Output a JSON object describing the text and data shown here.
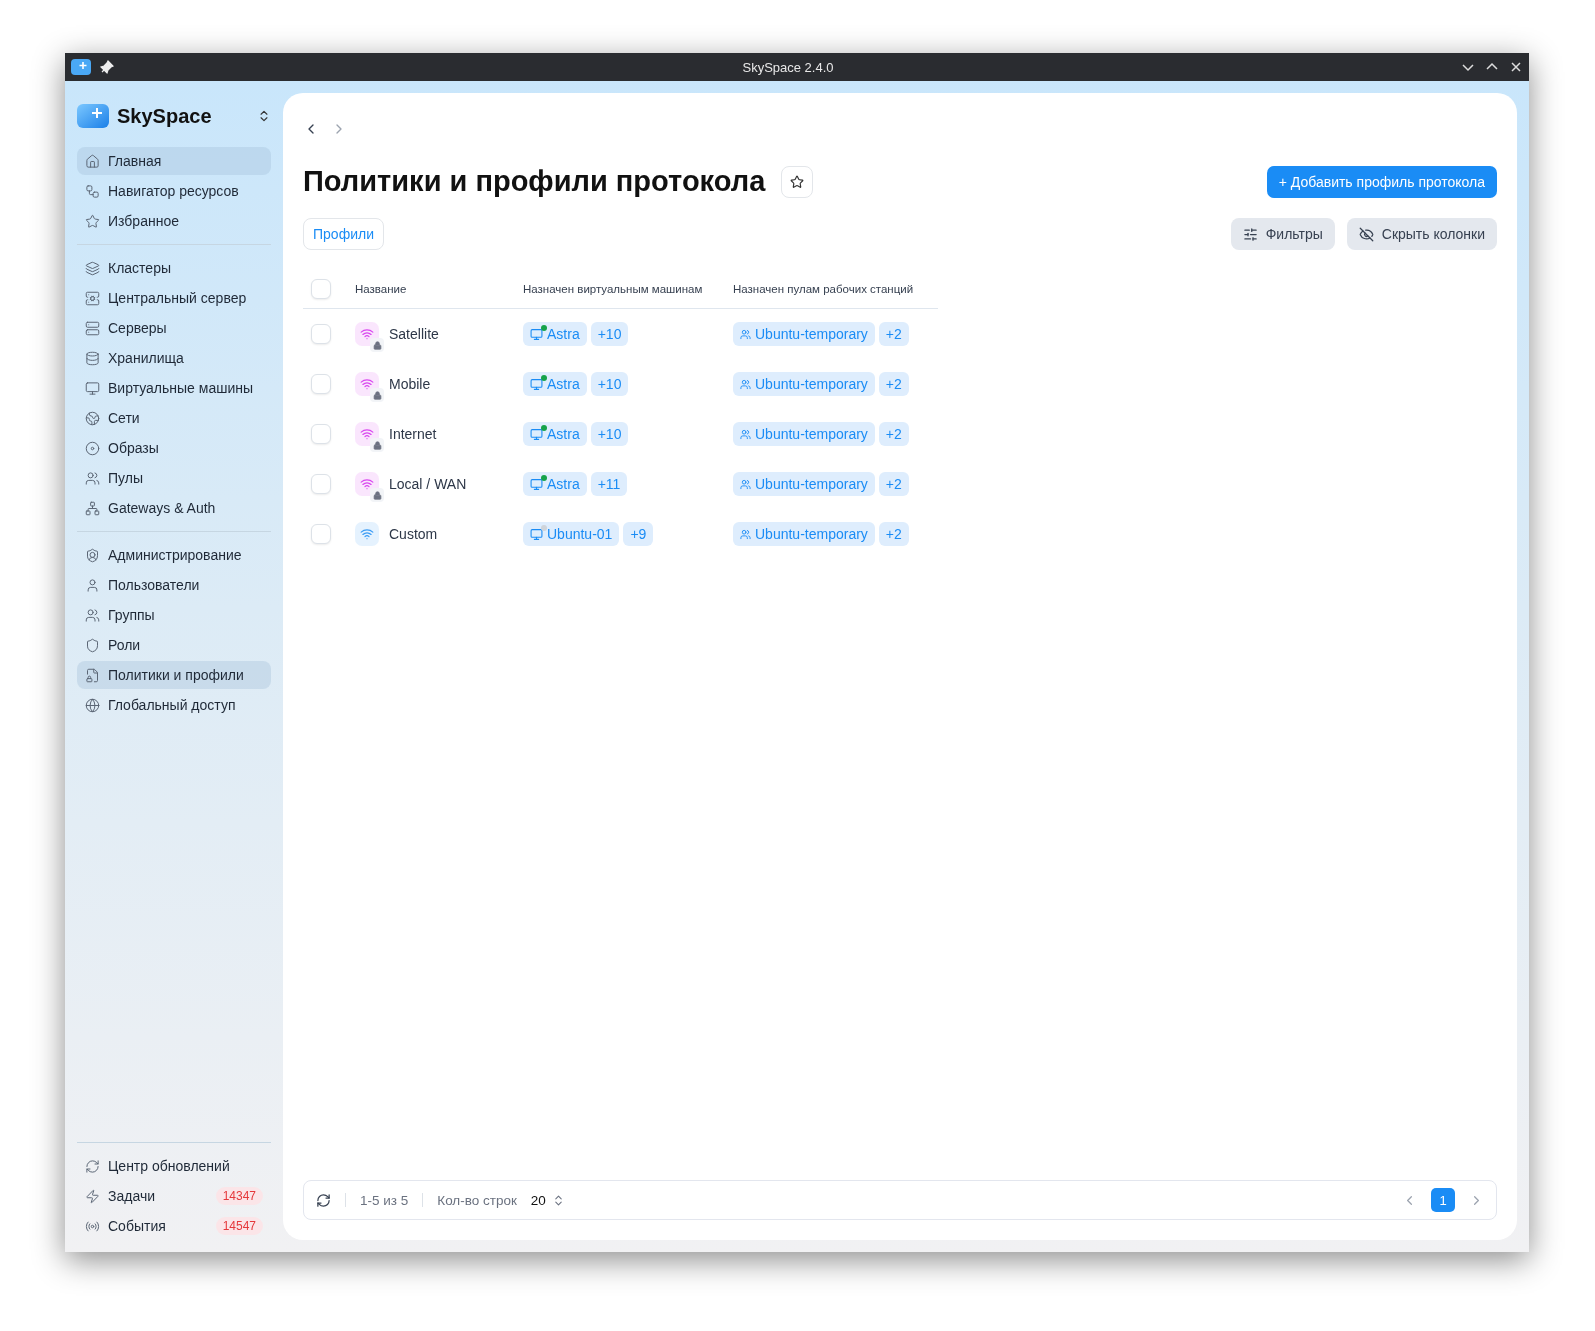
{
  "window": {
    "title": "SkySpace 2.4.0"
  },
  "sidebar": {
    "brand": "SkySpace",
    "groups": [
      [
        {
          "label": "Главная",
          "selected": true
        },
        {
          "label": "Навигатор ресурсов",
          "selected": false
        },
        {
          "label": "Избранное",
          "selected": false
        }
      ],
      [
        {
          "label": "Кластеры",
          "selected": false
        },
        {
          "label": "Центральный сервер",
          "selected": false
        },
        {
          "label": "Серверы",
          "selected": false
        },
        {
          "label": "Хранилища",
          "selected": false
        },
        {
          "label": "Виртуальные машины",
          "selected": false
        },
        {
          "label": "Сети",
          "selected": false
        },
        {
          "label": "Образы",
          "selected": false
        },
        {
          "label": "Пулы",
          "selected": false
        },
        {
          "label": "Gateways & Auth",
          "selected": false
        }
      ],
      [
        {
          "label": "Администрирование",
          "selected": false
        },
        {
          "label": "Пользователи",
          "selected": false
        },
        {
          "label": "Группы",
          "selected": false
        },
        {
          "label": "Роли",
          "selected": false
        },
        {
          "label": "Политики и профили",
          "selected": true
        },
        {
          "label": "Глобальный доступ",
          "selected": false
        }
      ]
    ],
    "footer": [
      {
        "label": "Центр обновлений"
      },
      {
        "label": "Задачи",
        "badge": "14347"
      },
      {
        "label": "События",
        "badge": "14547"
      }
    ]
  },
  "page": {
    "title": "Политики и профили протокола",
    "add_button": "+ Добавить профиль протокола",
    "tab": "Профили",
    "filters_button": "Фильтры",
    "hide_columns_button": "Скрыть колонки"
  },
  "table": {
    "select_all_checked": false,
    "columns": [
      "Название",
      "Назначен виртуальным машинам",
      "Назначен пулам рабочих станций"
    ],
    "rows": [
      {
        "checked": false,
        "name": "Satellite",
        "color": "#d946ef",
        "locked": true,
        "vm": {
          "name": "Astra",
          "online": true,
          "more": "+10"
        },
        "pool": {
          "name": "Ubuntu-temporary",
          "more": "+2"
        }
      },
      {
        "checked": false,
        "name": "Mobile",
        "color": "#d946ef",
        "locked": true,
        "vm": {
          "name": "Astra",
          "online": true,
          "more": "+10"
        },
        "pool": {
          "name": "Ubuntu-temporary",
          "more": "+2"
        }
      },
      {
        "checked": false,
        "name": "Internet",
        "color": "#d946ef",
        "locked": true,
        "vm": {
          "name": "Astra",
          "online": true,
          "more": "+10"
        },
        "pool": {
          "name": "Ubuntu-temporary",
          "more": "+2"
        }
      },
      {
        "checked": false,
        "name": "Local / WAN",
        "color": "#d946ef",
        "locked": true,
        "vm": {
          "name": "Astra",
          "online": true,
          "more": "+11"
        },
        "pool": {
          "name": "Ubuntu-temporary",
          "more": "+2"
        }
      },
      {
        "checked": false,
        "name": "Custom",
        "color": "#3b9cf5",
        "locked": false,
        "vm": {
          "name": "Ubuntu-01",
          "online": false,
          "more": "+9"
        },
        "pool": {
          "name": "Ubuntu-temporary",
          "more": "+2"
        }
      }
    ]
  },
  "pager": {
    "range": "1-5 из 5",
    "rows_label": "Кол-во строк",
    "rows_value": "20",
    "pages": [
      {
        "label": "1",
        "selected": true
      }
    ]
  }
}
